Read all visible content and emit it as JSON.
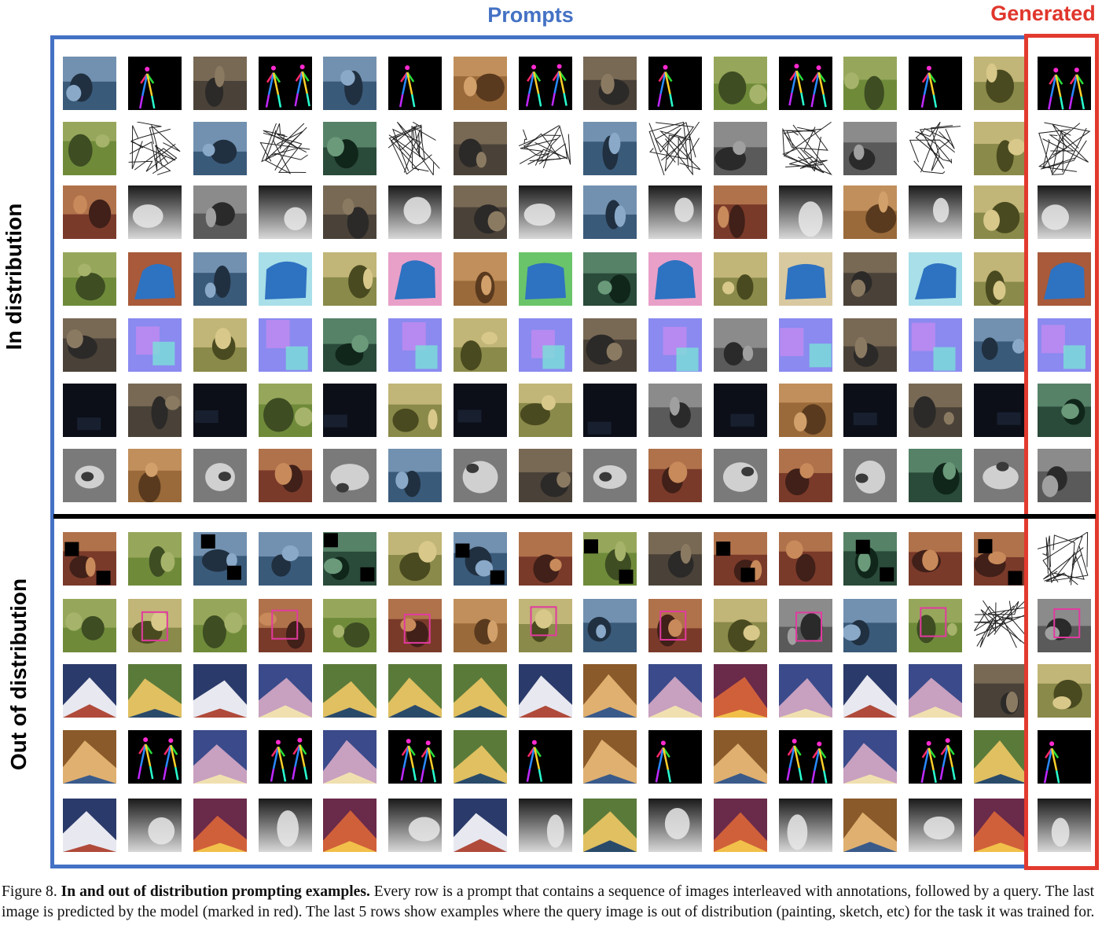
{
  "header": {
    "prompts_label": "Prompts",
    "generated_label": "Generated"
  },
  "side_labels": {
    "in_distribution": "In distribution",
    "out_of_distribution": "Out of distribution"
  },
  "caption": {
    "figure_label": "Figure 8.",
    "title": "In and out of distribution prompting examples.",
    "body": "Every row is a prompt that contains a sequence of images interleaved with annotations, followed by a query. The last image is predicted by the model (marked in red). The last 5 rows show examples where the query image is out of distribution (painting, sketch, etc) for the task it was trained for."
  },
  "rows": [
    {
      "task": "pose",
      "group": "in",
      "tiles": [
        "photo",
        "pose",
        "photo",
        "pose",
        "photo",
        "pose",
        "photo",
        "pose",
        "photo",
        "pose",
        "photo",
        "pose",
        "photo",
        "pose",
        "photo",
        "pose"
      ]
    },
    {
      "task": "edges",
      "group": "in",
      "tiles": [
        "photo",
        "edge",
        "photo",
        "edge",
        "photo",
        "edge",
        "photo",
        "edge",
        "photo",
        "edge",
        "photo",
        "edge",
        "photo",
        "edge",
        "photo",
        "edge"
      ]
    },
    {
      "task": "depth",
      "group": "in",
      "tiles": [
        "photo",
        "depth",
        "photo",
        "depth",
        "photo",
        "depth",
        "photo",
        "depth",
        "photo",
        "depth",
        "photo",
        "depth",
        "photo",
        "depth",
        "photo",
        "depth"
      ]
    },
    {
      "task": "segmentation",
      "group": "in",
      "tiles": [
        "photo",
        "seg",
        "photo",
        "seg",
        "photo",
        "seg",
        "photo",
        "seg",
        "photo",
        "seg",
        "photo",
        "seg",
        "photo",
        "seg",
        "photo",
        "seg"
      ]
    },
    {
      "task": "normals",
      "group": "in",
      "tiles": [
        "photo",
        "normal",
        "photo",
        "normal",
        "photo",
        "normal",
        "photo",
        "normal",
        "photo",
        "normal",
        "photo",
        "normal",
        "photo",
        "normal",
        "photo",
        "normal"
      ]
    },
    {
      "task": "low-light",
      "group": "in",
      "tiles": [
        "dark",
        "photo",
        "dark",
        "photo",
        "dark",
        "photo",
        "dark",
        "photo",
        "dark",
        "photo",
        "dark",
        "photo",
        "dark",
        "photo",
        "dark",
        "photo"
      ]
    },
    {
      "task": "colorization",
      "group": "in",
      "tiles": [
        "gray",
        "photo",
        "gray",
        "photo",
        "gray",
        "photo",
        "gray",
        "photo",
        "gray",
        "photo",
        "gray",
        "photo",
        "gray",
        "photo",
        "gray",
        "photo"
      ]
    },
    {
      "task": "inpainting",
      "group": "out",
      "tiles": [
        "masked",
        "photo",
        "masked",
        "photo",
        "masked",
        "photo",
        "masked",
        "photo",
        "masked",
        "photo",
        "masked",
        "photo",
        "masked",
        "photo",
        "masked",
        "sketch"
      ]
    },
    {
      "task": "detection",
      "group": "out",
      "tiles": [
        "photo",
        "boxed",
        "photo",
        "boxed",
        "photo",
        "boxed",
        "photo",
        "boxed",
        "photo",
        "boxed",
        "photo",
        "boxed",
        "photo",
        "boxed",
        "sketch",
        "boxed"
      ]
    },
    {
      "task": "style",
      "group": "out",
      "tiles": [
        "painting",
        "painting",
        "painting",
        "painting",
        "painting",
        "painting",
        "painting",
        "painting",
        "painting",
        "painting",
        "painting",
        "painting",
        "painting",
        "painting",
        "photo",
        "photo"
      ]
    },
    {
      "task": "pose-ood",
      "group": "out",
      "tiles": [
        "painting",
        "pose",
        "painting",
        "pose",
        "painting",
        "pose",
        "painting",
        "pose",
        "painting",
        "pose",
        "painting",
        "pose",
        "painting",
        "pose",
        "painting",
        "pose"
      ]
    },
    {
      "task": "depth-ood",
      "group": "out",
      "tiles": [
        "painting",
        "depth",
        "painting",
        "depth",
        "painting",
        "depth",
        "painting",
        "depth",
        "painting",
        "depth",
        "painting",
        "depth",
        "painting",
        "depth",
        "painting",
        "depth"
      ]
    }
  ],
  "colors": {
    "prompt_frame": "#4472c4",
    "generated_frame": "#e23a2e",
    "divider": "#000000"
  }
}
